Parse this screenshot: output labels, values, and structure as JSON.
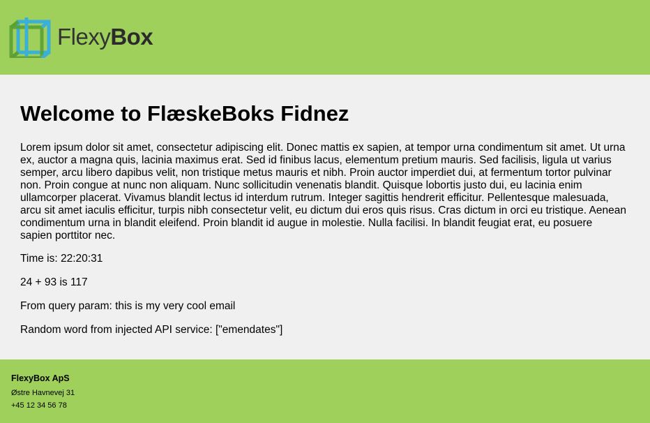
{
  "header": {
    "logo_text_light": "Flexy",
    "logo_text_bold": "Box",
    "logo_icon": "cube-logo-icon",
    "background_color": "#9ed05b"
  },
  "main": {
    "title": "Welcome to FlæskeBoks Fidnez",
    "lorem": "Lorem ipsum dolor sit amet, consectetur adipiscing elit. Donec mattis ex sapien, at tempor urna condimentum sit amet. Ut urna ex, auctor a magna quis, lacinia maximus erat. Sed id finibus lacus, elementum pretium mauris. Sed facilisis, ligula ut varius semper, arcu libero dapibus velit, non tristique metus mauris et nibh. Proin auctor imperdiet dui, at fermentum tortor pulvinar non. Proin congue at nunc non aliquam. Nunc sollicitudin venenatis blandit. Quisque lobortis justo dui, eu lacinia enim ullamcorper placerat. Vivamus blandit lectus id interdum rutrum. Integer sagittis hendrerit efficitur. Pellentesque malesuada, arcu sit amet iaculis efficitur, turpis nibh consectetur velit, eu dictum dui eros quis risus. Cras dictum in orci eu tristique. Aenean condimentum urna in blandit eleifend. Proin blandit id augue in molestie. Nulla facilisi. In blandit feugiat erat, eu posuere sapien porttitor nec.",
    "time_line": "Time is: 22:20:31",
    "sum_line": "24 + 93 is 117",
    "query_line": "From query param: this is my very cool email",
    "random_line": "Random word from injected API service: [\"emendates\"]"
  },
  "footer": {
    "company": "FlexyBox ApS",
    "address": "Østre Havnevej 31",
    "phone": "+45 12 34 56 78",
    "background_color": "#9ed05b"
  }
}
